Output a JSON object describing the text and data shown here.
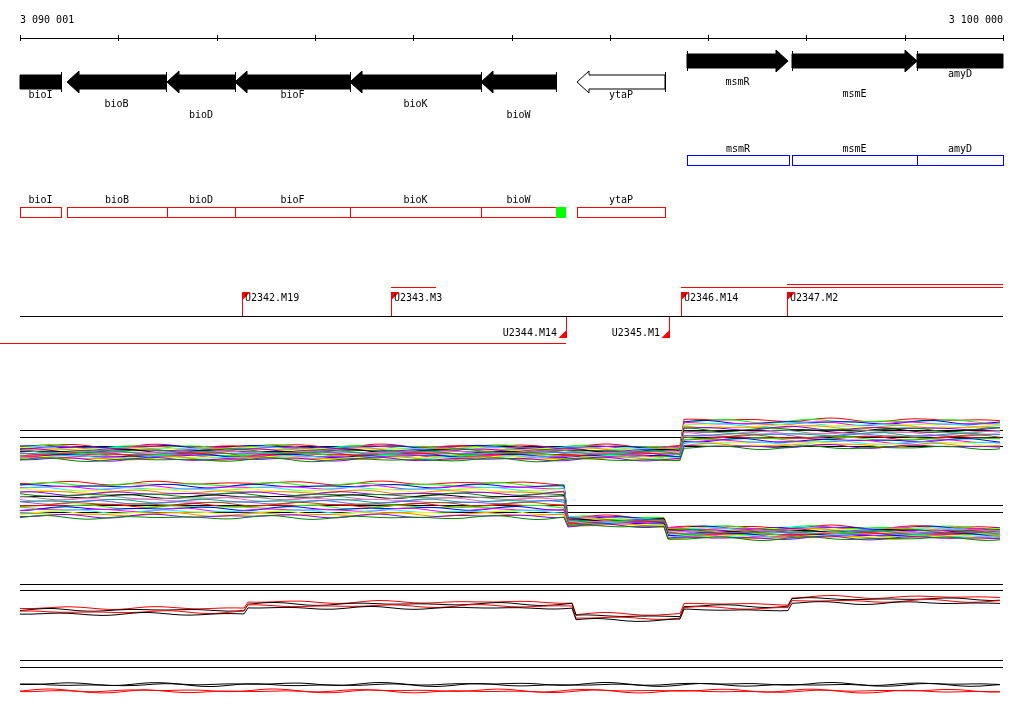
{
  "ruler": {
    "start_label": "3 090 001",
    "end_label": "3 100 000"
  },
  "gene_track": [
    {
      "name": "bioI",
      "kind": "reverse",
      "filled": true,
      "arrow": false
    },
    {
      "name": "bioB",
      "kind": "reverse",
      "filled": true,
      "arrow": true
    },
    {
      "name": "bioD",
      "kind": "reverse",
      "filled": true,
      "arrow": true
    },
    {
      "name": "bioF",
      "kind": "reverse",
      "filled": true,
      "arrow": true
    },
    {
      "name": "bioK",
      "kind": "reverse",
      "filled": true,
      "arrow": true
    },
    {
      "name": "bioW",
      "kind": "reverse",
      "filled": true,
      "arrow": true
    },
    {
      "name": "ytaP",
      "kind": "reverse",
      "filled": false,
      "arrow": true
    },
    {
      "name": "msmR",
      "kind": "forward",
      "filled": true,
      "arrow": true
    },
    {
      "name": "msmE",
      "kind": "forward",
      "filled": true,
      "arrow": true
    },
    {
      "name": "amyD",
      "kind": "forward",
      "filled": true,
      "arrow": false
    }
  ],
  "plus_boxes": [
    {
      "name": "msmR"
    },
    {
      "name": "msmE"
    },
    {
      "name": "amyD"
    }
  ],
  "minus_boxes": [
    {
      "name": "bioI",
      "marked": false
    },
    {
      "name": "bioB",
      "marked": false
    },
    {
      "name": "bioD",
      "marked": false
    },
    {
      "name": "bioF",
      "marked": false
    },
    {
      "name": "bioK",
      "marked": false
    },
    {
      "name": "bioW",
      "marked": true
    },
    {
      "name": "ytaP",
      "marked": false
    }
  ],
  "segments": [
    {
      "label": "U2342.M19",
      "kind": "forward"
    },
    {
      "label": "U2343.M3",
      "kind": "forward"
    },
    {
      "label": "U2344.M14",
      "kind": "reverse"
    },
    {
      "label": "U2345.M1",
      "kind": "reverse"
    },
    {
      "label": "U2346.M14",
      "kind": "forward"
    },
    {
      "label": "U2347.M2",
      "kind": "forward"
    }
  ]
}
